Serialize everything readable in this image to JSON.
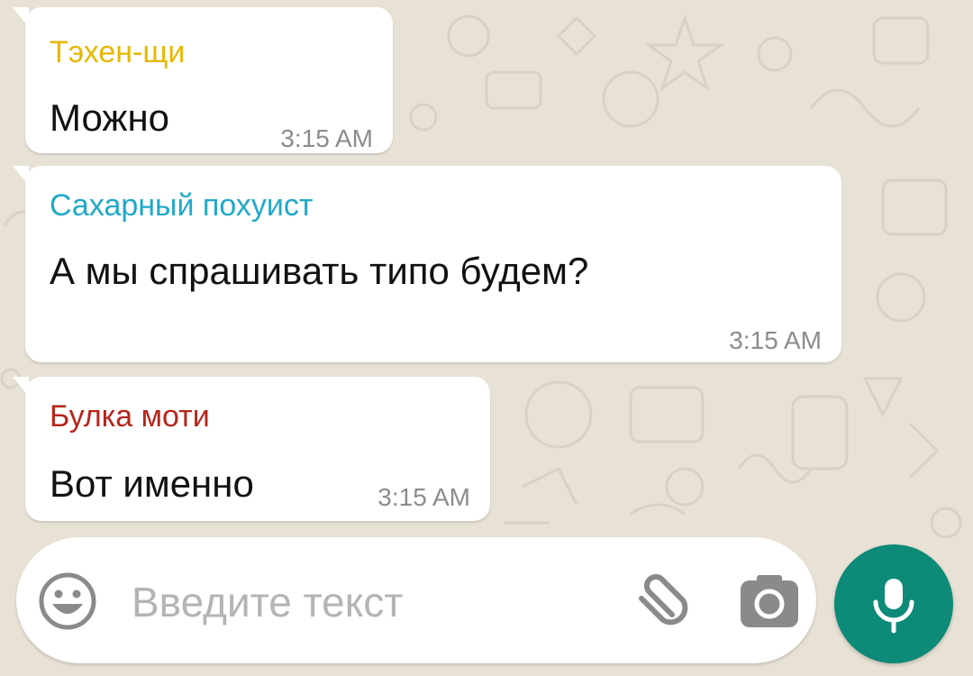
{
  "messages": [
    {
      "sender": "Тэхен-щи",
      "sender_color": "#e6b800",
      "text": "Можно",
      "time": "3:15 AM"
    },
    {
      "sender": "Сахарный похуист",
      "sender_color": "#22a9c7",
      "text": "А мы спрашивать типо будем?",
      "time": "3:15 AM"
    },
    {
      "sender": "Булка моти",
      "sender_color": "#b5261c",
      "text": "Вот именно",
      "time": "3:15 AM"
    }
  ],
  "composer": {
    "placeholder": "Введите текст",
    "icons": [
      "emoji-icon",
      "paperclip-icon",
      "camera-icon",
      "microphone-icon"
    ],
    "mic_button_color": "#0d8a78"
  }
}
